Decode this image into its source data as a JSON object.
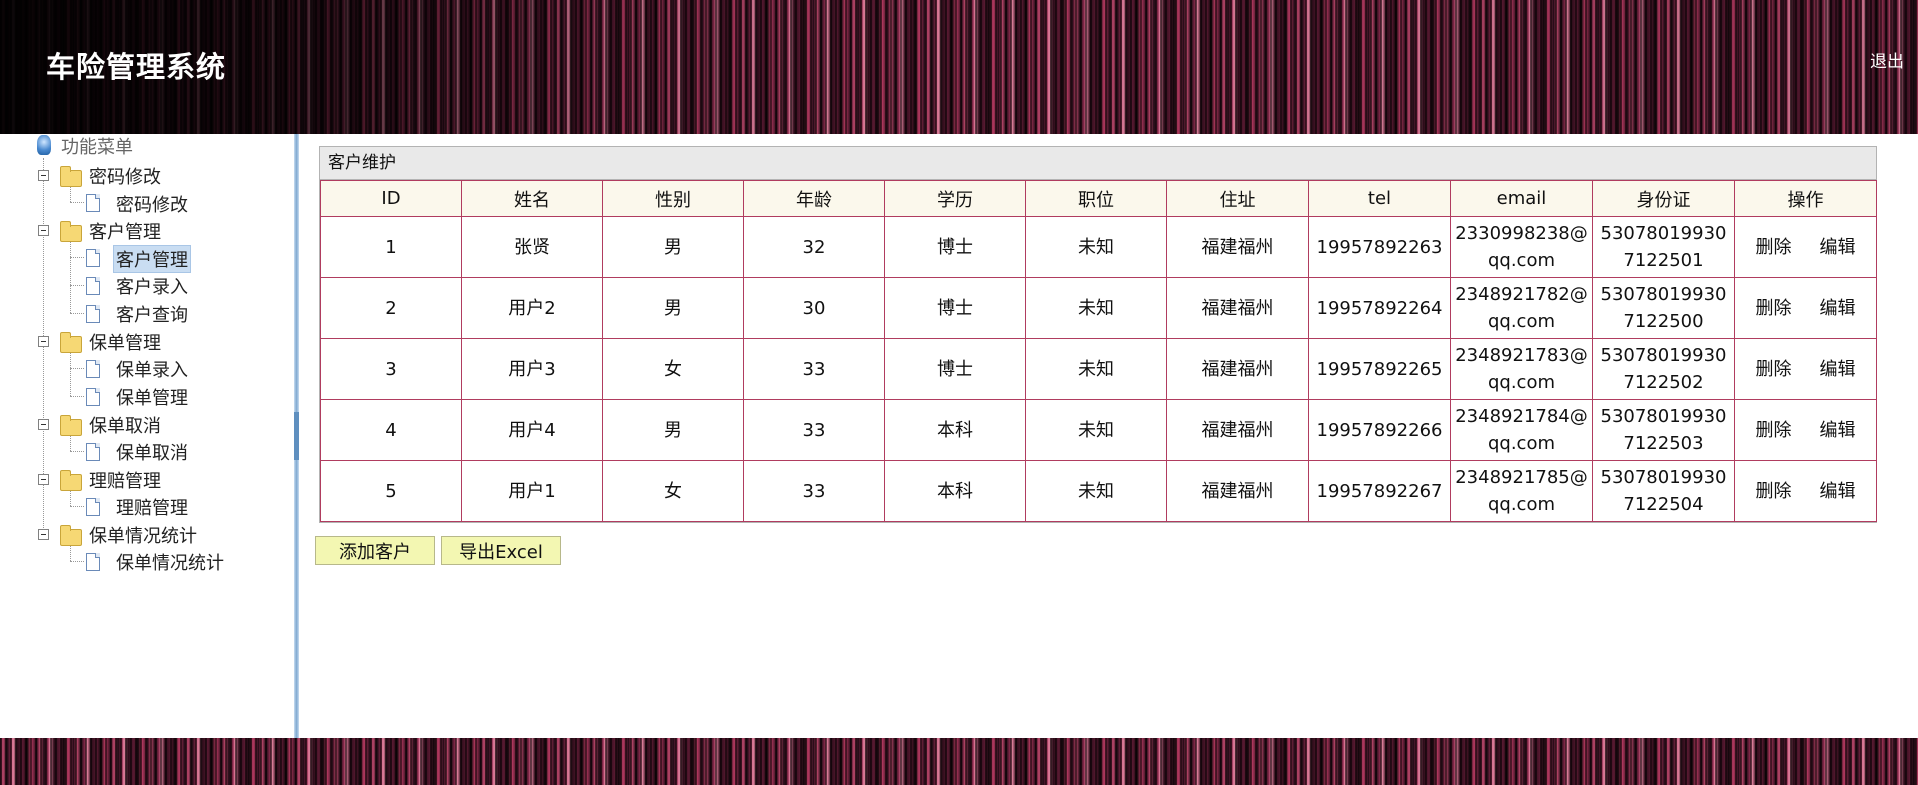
{
  "app": {
    "title": "车险管理系统",
    "logout": "退出"
  },
  "menu": {
    "root": "功能菜单",
    "groups": [
      {
        "label": "密码修改",
        "items": [
          "密码修改"
        ]
      },
      {
        "label": "客户管理",
        "items": [
          "客户管理",
          "客户录入",
          "客户查询"
        ]
      },
      {
        "label": "保单管理",
        "items": [
          "保单录入",
          "保单管理"
        ]
      },
      {
        "label": "保单取消",
        "items": [
          "保单取消"
        ]
      },
      {
        "label": "理赔管理",
        "items": [
          "理赔管理"
        ]
      },
      {
        "label": "保单情况统计",
        "items": [
          "保单情况统计"
        ]
      }
    ],
    "selected": "客户管理"
  },
  "panel": {
    "title": "客户维护"
  },
  "table": {
    "columns": [
      "ID",
      "姓名",
      "性别",
      "年龄",
      "学历",
      "职位",
      "住址",
      "tel",
      "email",
      "身份证",
      "操作"
    ],
    "rows": [
      [
        "1",
        "张贤",
        "男",
        "32",
        "博士",
        "未知",
        "福建福州",
        "19957892263",
        "2330998238@qq.com",
        "530780199307122501"
      ],
      [
        "2",
        "用户2",
        "男",
        "30",
        "博士",
        "未知",
        "福建福州",
        "19957892264",
        "2348921782@qq.com",
        "530780199307122500"
      ],
      [
        "3",
        "用户3",
        "女",
        "33",
        "博士",
        "未知",
        "福建福州",
        "19957892265",
        "2348921783@qq.com",
        "530780199307122502"
      ],
      [
        "4",
        "用户4",
        "男",
        "33",
        "本科",
        "未知",
        "福建福州",
        "19957892266",
        "2348921784@qq.com",
        "530780199307122503"
      ],
      [
        "5",
        "用户1",
        "女",
        "33",
        "本科",
        "未知",
        "福建福州",
        "19957892267",
        "2348921785@qq.com",
        "530780199307122504"
      ]
    ],
    "actions": {
      "delete": "删除",
      "edit": "编辑"
    }
  },
  "buttons": {
    "add": "添加客户",
    "export": "导出Excel"
  }
}
